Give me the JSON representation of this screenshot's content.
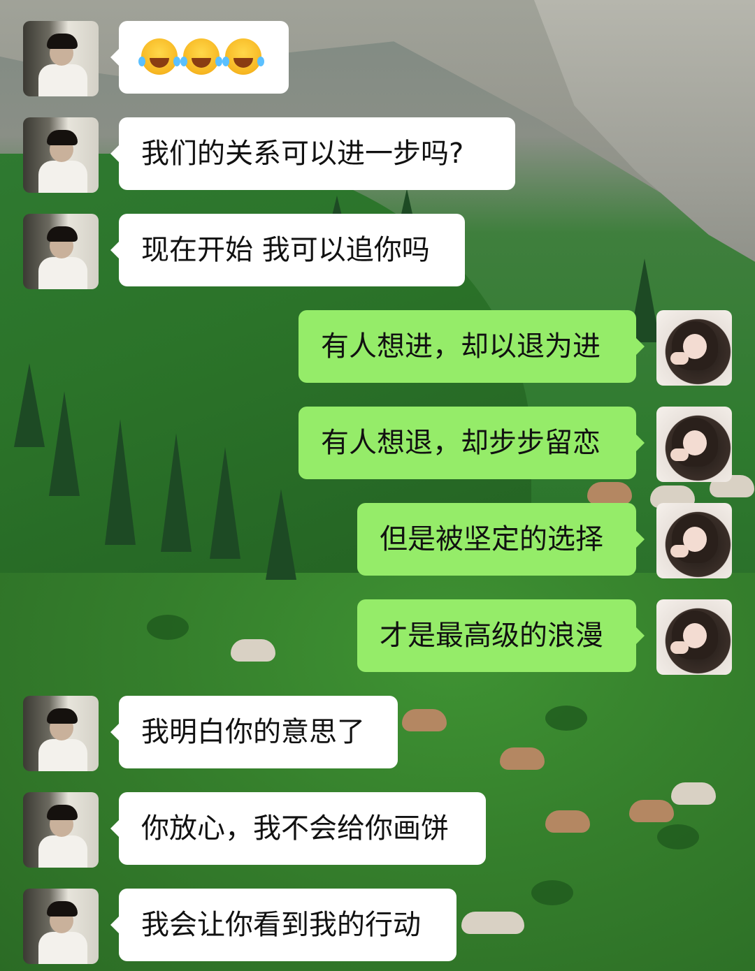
{
  "chat": {
    "messages": [
      {
        "sender": "other",
        "text": "😂😂😂",
        "emoji": [
          "face-with-tears-of-joy",
          "face-with-tears-of-joy",
          "face-with-tears-of-joy"
        ]
      },
      {
        "sender": "other",
        "text": "我们的关系可以进一步吗?"
      },
      {
        "sender": "other",
        "text": "现在开始 我可以追你吗"
      },
      {
        "sender": "self",
        "text": "有人想进，却以退为进"
      },
      {
        "sender": "self",
        "text": "有人想退，却步步留恋"
      },
      {
        "sender": "self",
        "text": "但是被坚定的选择"
      },
      {
        "sender": "self",
        "text": "才是最高级的浪漫"
      },
      {
        "sender": "other",
        "text": "我明白你的意思了"
      },
      {
        "sender": "other",
        "text": "你放心，我不会给你画饼"
      },
      {
        "sender": "other",
        "text": "我会让你看到我的行动"
      }
    ]
  },
  "colors": {
    "incoming_bubble": "#ffffff",
    "outgoing_bubble": "#95ec69",
    "text": "#111111"
  }
}
